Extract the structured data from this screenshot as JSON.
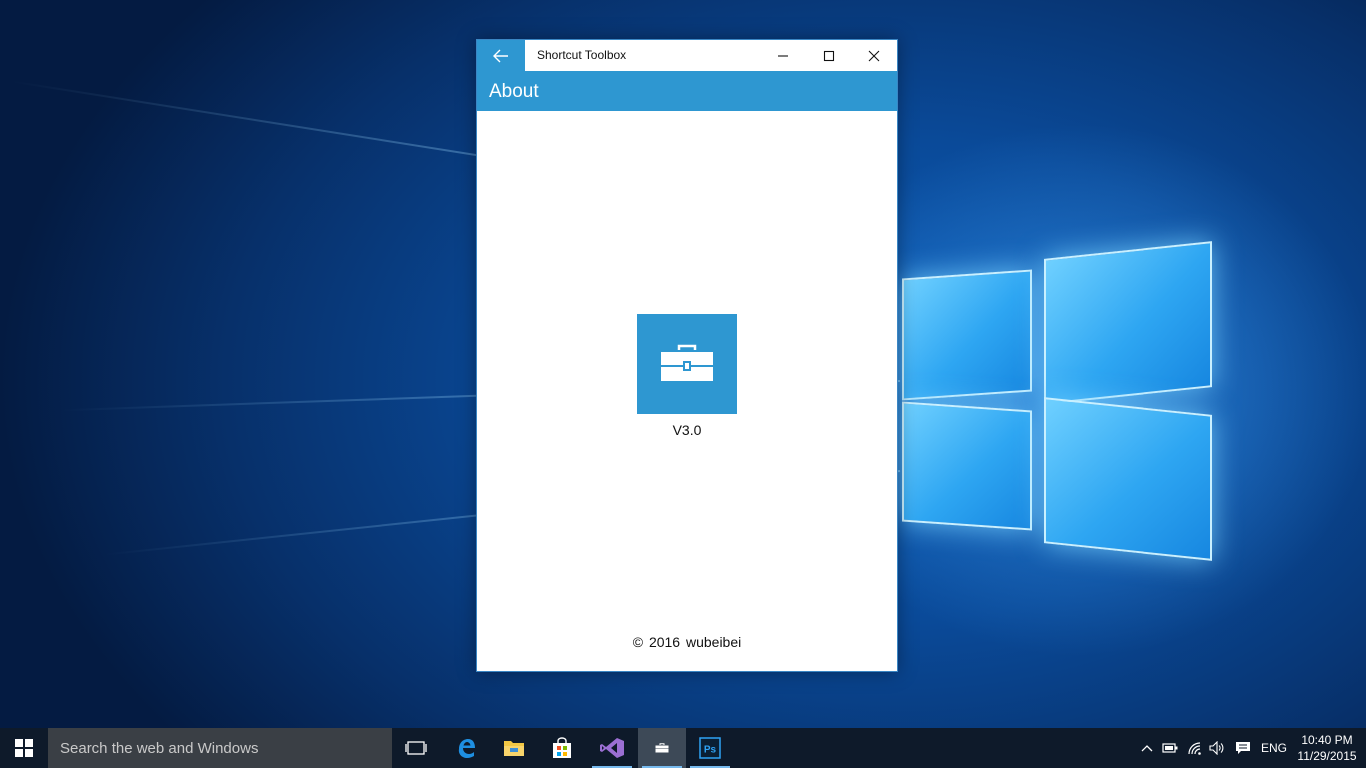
{
  "window": {
    "title": "Shortcut Toolbox",
    "page_title": "About",
    "version": "V3.0",
    "copyright": "© 2016  wubeibei"
  },
  "taskbar": {
    "search_placeholder": "Search the web and Windows",
    "language": "ENG",
    "time": "10:40 PM",
    "date": "11/29/2015",
    "apps": [
      "task-view-icon",
      "edge-icon",
      "file-explorer-icon",
      "store-icon",
      "visual-studio-icon",
      "shortcut-toolbox-icon",
      "photoshop-icon"
    ]
  },
  "colors": {
    "accent": "#2e97d1",
    "taskbar": "#0e1a2a",
    "search_box": "#3a3f45"
  }
}
